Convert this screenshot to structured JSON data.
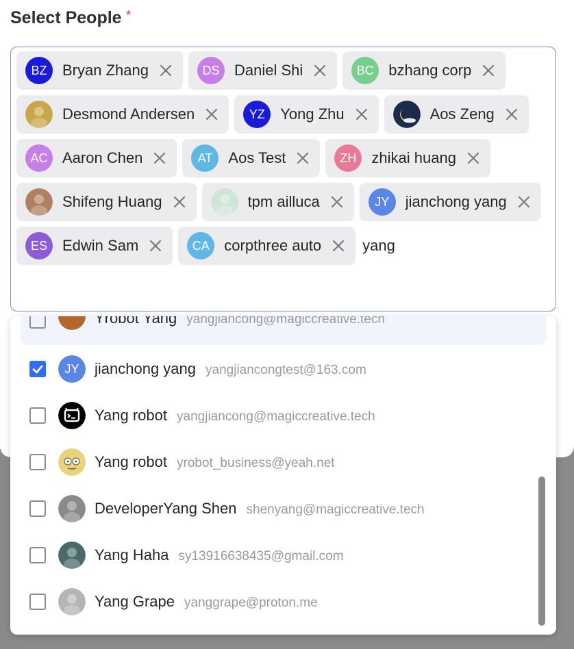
{
  "form": {
    "label": "Select People",
    "required_mark": "*"
  },
  "selected_people": [
    {
      "name": "Bryan Zhang",
      "initials": "BZ",
      "color": "#1a1adb",
      "avatar_kind": "initials"
    },
    {
      "name": "Daniel Shi",
      "initials": "DS",
      "color": "#c77ee6",
      "avatar_kind": "initials"
    },
    {
      "name": "bzhang corp",
      "initials": "BC",
      "color": "#76cf8d",
      "avatar_kind": "initials"
    },
    {
      "name": "Desmond Andersen",
      "initials": "",
      "color": "#c9a64a",
      "avatar_kind": "photo"
    },
    {
      "name": "Yong Zhu",
      "initials": "YZ",
      "color": "#1a1adb",
      "avatar_kind": "initials"
    },
    {
      "name": "Aos Zeng",
      "initials": "",
      "color": "#1c2b4a",
      "avatar_kind": "moon"
    },
    {
      "name": "Aaron Chen",
      "initials": "AC",
      "color": "#c77ee6",
      "avatar_kind": "initials"
    },
    {
      "name": "Aos Test",
      "initials": "AT",
      "color": "#5fb7e6",
      "avatar_kind": "initials"
    },
    {
      "name": "zhikai huang",
      "initials": "ZH",
      "color": "#e87a98",
      "avatar_kind": "initials"
    },
    {
      "name": "Shifeng Huang",
      "initials": "",
      "color": "#b08060",
      "avatar_kind": "photo"
    },
    {
      "name": "tpm ailluca",
      "initials": "",
      "color": "#cfe5d6",
      "avatar_kind": "photo"
    },
    {
      "name": "jianchong yang",
      "initials": "JY",
      "color": "#5b86e8",
      "avatar_kind": "initials"
    },
    {
      "name": "Edwin Sam",
      "initials": "ES",
      "color": "#8b5cd6",
      "avatar_kind": "initials"
    },
    {
      "name": "corpthree auto",
      "initials": "CA",
      "color": "#5fb7e6",
      "avatar_kind": "initials"
    }
  ],
  "search": {
    "value": "yang"
  },
  "dropdown": {
    "partial_top": {
      "name": "Yrobot Yang",
      "email": "yangjiancong@magiccreative.tech"
    },
    "options": [
      {
        "name": "jianchong yang",
        "email": "yangjiancongtest@163.com",
        "checked": true,
        "initials": "JY",
        "color": "#5b86e8",
        "avatar_kind": "initials"
      },
      {
        "name": "Yang robot",
        "email": "yangjiancong@magiccreative.tech",
        "checked": false,
        "initials": "",
        "color": "#000000",
        "avatar_kind": "robot"
      },
      {
        "name": "Yang robot",
        "email": "yrobot_business@yeah.net",
        "checked": false,
        "initials": "",
        "color": "#e8d27a",
        "avatar_kind": "face"
      },
      {
        "name": "DeveloperYang Shen",
        "email": "shenyang@magiccreative.tech",
        "checked": false,
        "initials": "",
        "color": "#8a8a8a",
        "avatar_kind": "photo"
      },
      {
        "name": "Yang Haha",
        "email": "sy13916638435@gmail.com",
        "checked": false,
        "initials": "",
        "color": "#4a6a6a",
        "avatar_kind": "photo"
      },
      {
        "name": "Yang Grape",
        "email": "yanggrape@proton.me",
        "checked": false,
        "initials": "",
        "color": "#b5b5b5",
        "avatar_kind": "photo"
      }
    ]
  },
  "icons": {
    "remove": "close-icon",
    "check": "check-icon"
  },
  "colors": {
    "accent": "#2e6df6",
    "focus_border": "#6f8cf0",
    "required": "#e5534b",
    "tag_bg": "#ececef"
  }
}
